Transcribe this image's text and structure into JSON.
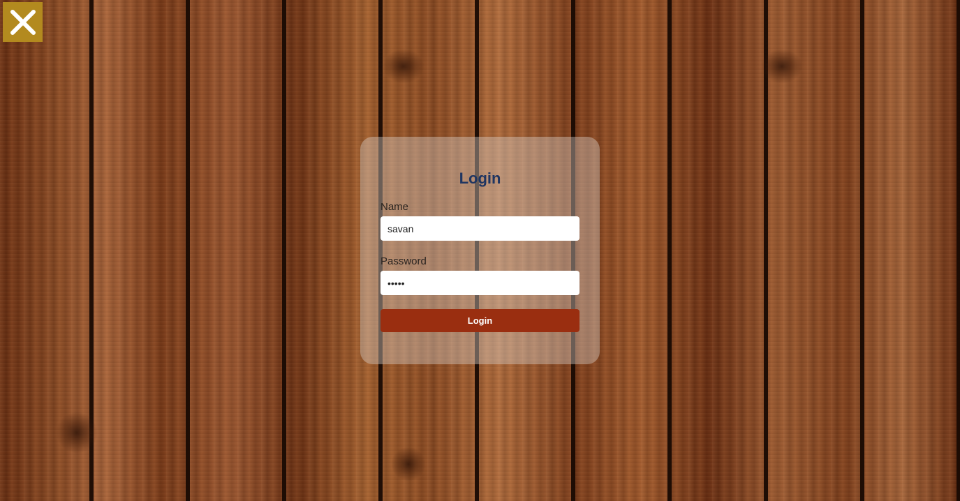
{
  "close_icon": "close-icon",
  "colors": {
    "close_bg": "#b38a1f",
    "title": "#1f3561",
    "button_bg": "#9a2e10"
  },
  "login_form": {
    "title": "Login",
    "name_label": "Name",
    "name_value": "savan",
    "password_label": "Password",
    "password_value": "•••••",
    "submit_label": "Login"
  }
}
